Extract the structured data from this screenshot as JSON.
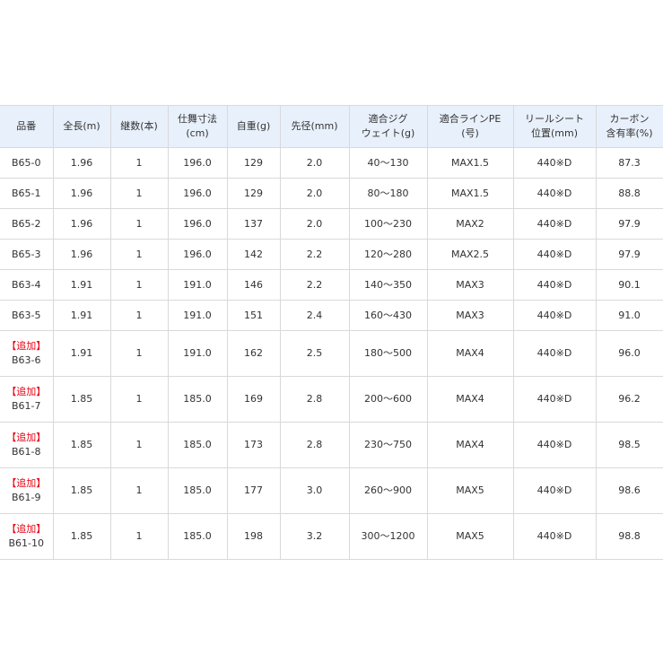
{
  "chart_data": {
    "type": "table",
    "columns": [
      [
        "品番"
      ],
      [
        "全長(m)"
      ],
      [
        "継数(本)"
      ],
      [
        "仕舞寸法",
        "(cm)"
      ],
      [
        "自重(g)"
      ],
      [
        "先径(mm)"
      ],
      [
        "適合ジグ",
        "ウェイト(g)"
      ],
      [
        "適合ラインPE",
        "(号)"
      ],
      [
        "リールシート",
        "位置(mm)"
      ],
      [
        "カーボン",
        "含有率(%)"
      ]
    ],
    "rows": [
      {
        "tag": "",
        "model": "B65-0",
        "length_m": "1.96",
        "pieces": "1",
        "closed_cm": "196.0",
        "weight_g": "129",
        "tip_mm": "2.0",
        "jig_g": "40～130",
        "line_pe": "MAX1.5",
        "reel_seat": "440※D",
        "carbon_pct": "87.3"
      },
      {
        "tag": "",
        "model": "B65-1",
        "length_m": "1.96",
        "pieces": "1",
        "closed_cm": "196.0",
        "weight_g": "129",
        "tip_mm": "2.0",
        "jig_g": "80～180",
        "line_pe": "MAX1.5",
        "reel_seat": "440※D",
        "carbon_pct": "88.8"
      },
      {
        "tag": "",
        "model": "B65-2",
        "length_m": "1.96",
        "pieces": "1",
        "closed_cm": "196.0",
        "weight_g": "137",
        "tip_mm": "2.0",
        "jig_g": "100～230",
        "line_pe": "MAX2",
        "reel_seat": "440※D",
        "carbon_pct": "97.9"
      },
      {
        "tag": "",
        "model": "B65-3",
        "length_m": "1.96",
        "pieces": "1",
        "closed_cm": "196.0",
        "weight_g": "142",
        "tip_mm": "2.2",
        "jig_g": "120～280",
        "line_pe": "MAX2.5",
        "reel_seat": "440※D",
        "carbon_pct": "97.9"
      },
      {
        "tag": "",
        "model": "B63-4",
        "length_m": "1.91",
        "pieces": "1",
        "closed_cm": "191.0",
        "weight_g": "146",
        "tip_mm": "2.2",
        "jig_g": "140～350",
        "line_pe": "MAX3",
        "reel_seat": "440※D",
        "carbon_pct": "90.1"
      },
      {
        "tag": "",
        "model": "B63-5",
        "length_m": "1.91",
        "pieces": "1",
        "closed_cm": "191.0",
        "weight_g": "151",
        "tip_mm": "2.4",
        "jig_g": "160～430",
        "line_pe": "MAX3",
        "reel_seat": "440※D",
        "carbon_pct": "91.0"
      },
      {
        "tag": "【追加】",
        "model": "B63-6",
        "length_m": "1.91",
        "pieces": "1",
        "closed_cm": "191.0",
        "weight_g": "162",
        "tip_mm": "2.5",
        "jig_g": "180～500",
        "line_pe": "MAX4",
        "reel_seat": "440※D",
        "carbon_pct": "96.0"
      },
      {
        "tag": "【追加】",
        "model": "B61-7",
        "length_m": "1.85",
        "pieces": "1",
        "closed_cm": "185.0",
        "weight_g": "169",
        "tip_mm": "2.8",
        "jig_g": "200～600",
        "line_pe": "MAX4",
        "reel_seat": "440※D",
        "carbon_pct": "96.2"
      },
      {
        "tag": "【追加】",
        "model": "B61-8",
        "length_m": "1.85",
        "pieces": "1",
        "closed_cm": "185.0",
        "weight_g": "173",
        "tip_mm": "2.8",
        "jig_g": "230～750",
        "line_pe": "MAX4",
        "reel_seat": "440※D",
        "carbon_pct": "98.5"
      },
      {
        "tag": "【追加】",
        "model": "B61-9",
        "length_m": "1.85",
        "pieces": "1",
        "closed_cm": "185.0",
        "weight_g": "177",
        "tip_mm": "3.0",
        "jig_g": "260～900",
        "line_pe": "MAX5",
        "reel_seat": "440※D",
        "carbon_pct": "98.6"
      },
      {
        "tag": "【追加】",
        "model": "B61-10",
        "length_m": "1.85",
        "pieces": "1",
        "closed_cm": "185.0",
        "weight_g": "198",
        "tip_mm": "3.2",
        "jig_g": "300～1200",
        "line_pe": "MAX5",
        "reel_seat": "440※D",
        "carbon_pct": "98.8"
      }
    ]
  },
  "colors": {
    "header_bg": "#e8f0fb",
    "border": "#d9d9d9",
    "text": "#333333",
    "added_tag": "#e60012"
  }
}
